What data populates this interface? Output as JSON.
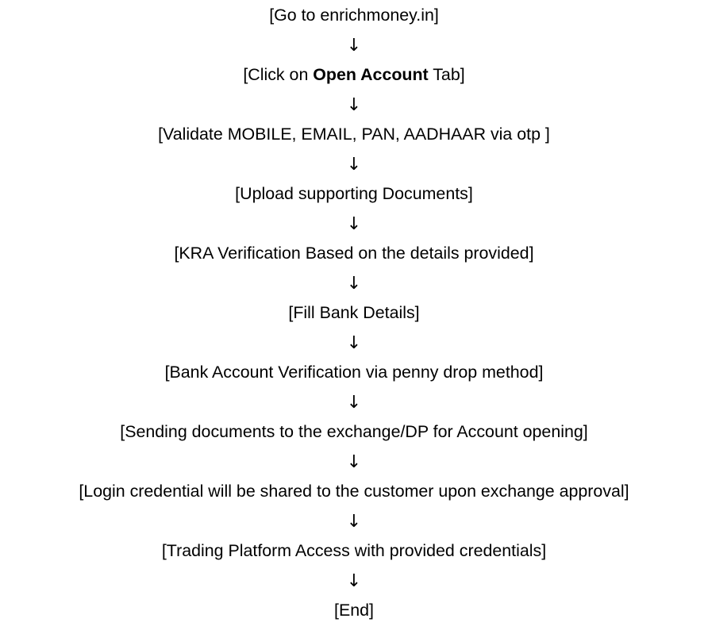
{
  "flowchart": {
    "steps": [
      {
        "text": "[Go to enrichmoney.in]"
      },
      {
        "prefix": "[Click on ",
        "bold": "Open Account",
        "suffix": " Tab]"
      },
      {
        "text": "[Validate MOBILE, EMAIL, PAN, AADHAAR via otp ]"
      },
      {
        "text": "[Upload supporting Documents]"
      },
      {
        "text": "[KRA Verification Based on the details provided]"
      },
      {
        "text": "[Fill Bank Details]"
      },
      {
        "text": "[Bank Account Verification via penny drop method]"
      },
      {
        "text": "[Sending documents to the exchange/DP for Account opening]"
      },
      {
        "text": "[Login credential will be shared to the customer upon exchange approval]"
      },
      {
        "text": "[Trading Platform Access with provided credentials]"
      },
      {
        "text": "[End]"
      }
    ],
    "arrow_glyph": "↓"
  }
}
